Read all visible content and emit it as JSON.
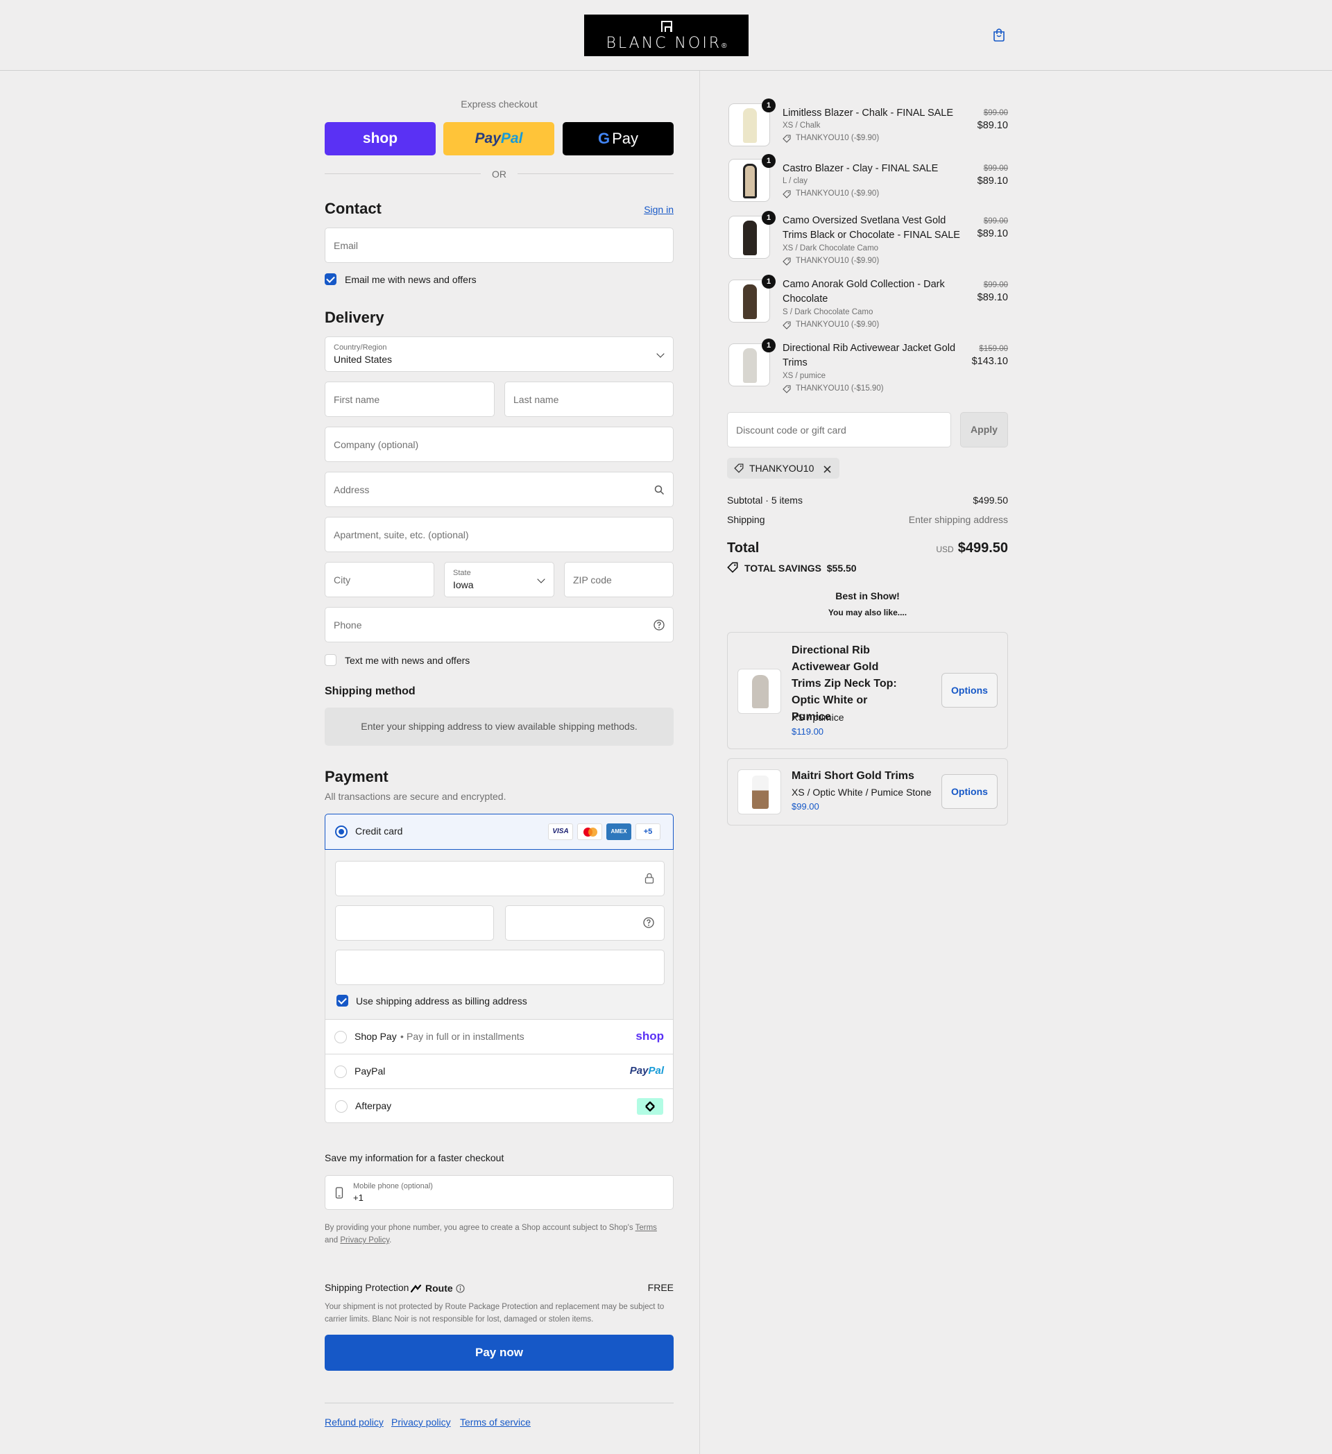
{
  "brand": {
    "name": "BLANC NOIR",
    "reg": "®"
  },
  "express": {
    "label": "Express checkout",
    "shop": "shop",
    "paypal_a": "Pay",
    "paypal_b": "Pal",
    "gpay_g": "G",
    "gpay": "Pay",
    "or": "OR"
  },
  "contact": {
    "title": "Contact",
    "sign_in": "Sign in",
    "email_placeholder": "Email",
    "email_opt_in": "Email me with news and offers"
  },
  "delivery": {
    "title": "Delivery",
    "country_label": "Country/Region",
    "country_value": "United States",
    "first_name": "First name",
    "last_name": "Last name",
    "company": "Company (optional)",
    "address": "Address",
    "apartment": "Apartment, suite, etc. (optional)",
    "city": "City",
    "state_label": "State",
    "state_value": "Iowa",
    "zip": "ZIP code",
    "phone": "Phone",
    "text_opt_in": "Text me with news and offers"
  },
  "shipping_method": {
    "title": "Shipping method",
    "notice": "Enter your shipping address to view available shipping methods."
  },
  "payment": {
    "title": "Payment",
    "subtitle": "All transactions are secure and encrypted.",
    "credit_card": "Credit card",
    "card_brands": [
      "VISA",
      "",
      "AMEX",
      "+5"
    ],
    "billing_same": "Use shipping address as billing address",
    "shop_pay": "Shop Pay",
    "shop_pay_desc": "Pay in full or in installments",
    "shop_logo": "shop",
    "paypal": "PayPal",
    "paypal_logo_a": "Pay",
    "paypal_logo_b": "Pal",
    "afterpay": "Afterpay"
  },
  "save_info": {
    "title": "Save my information for a faster checkout",
    "mobile_label": "Mobile phone (optional)",
    "mobile_value": "+1",
    "legal_a": "By providing your phone number, you agree to create a Shop account subject to Shop's ",
    "terms": "Terms",
    "legal_b": "and ",
    "privacy": "Privacy Policy",
    "legal_c": "."
  },
  "protection": {
    "label": "Shipping Protection",
    "route": "Route",
    "price": "FREE",
    "desc": "Your shipment is not protected by Route Package Protection and replacement may be subject to carrier limits. Blanc Noir is not responsible for lost, damaged or stolen items."
  },
  "pay_now": "Pay now",
  "footer": {
    "refund": "Refund policy",
    "privacy": "Privacy policy",
    "terms": "Terms of service"
  },
  "order": {
    "items": [
      {
        "name": "Limitless Blazer - Chalk - FINAL SALE",
        "variant": "XS / Chalk",
        "discount": "THANKYOU10 (-$9.90)",
        "old": "$99.00",
        "price": "$89.10",
        "qty": "1"
      },
      {
        "name": "Castro Blazer - Clay - FINAL SALE",
        "variant": "L / clay",
        "discount": "THANKYOU10 (-$9.90)",
        "old": "$99.00",
        "price": "$89.10",
        "qty": "1"
      },
      {
        "name": "Camo Oversized Svetlana Vest Gold Trims Black or Chocolate - FINAL SALE",
        "variant": "XS / Dark Chocolate Camo",
        "discount": "THANKYOU10 (-$9.90)",
        "old": "$99.00",
        "price": "$89.10",
        "qty": "1"
      },
      {
        "name": "Camo Anorak Gold Collection - Dark Chocolate",
        "variant": "S / Dark Chocolate Camo",
        "discount": "THANKYOU10 (-$9.90)",
        "old": "$99.00",
        "price": "$89.10",
        "qty": "1"
      },
      {
        "name": "Directional Rib Activewear Jacket Gold Trims",
        "variant": "XS / pumice",
        "discount": "THANKYOU10 (-$15.90)",
        "old": "$159.00",
        "price": "$143.10",
        "qty": "1"
      }
    ],
    "discount_placeholder": "Discount code or gift card",
    "apply": "Apply",
    "applied_code": "THANKYOU10",
    "subtotal_label": "Subtotal · 5 items",
    "subtotal": "$499.50",
    "shipping_label": "Shipping",
    "shipping_value": "Enter shipping address",
    "total_label": "Total",
    "currency": "USD",
    "total": "$499.50",
    "savings_label": "TOTAL SAVINGS",
    "savings": "$55.50"
  },
  "upsell": {
    "title": "Best in Show!",
    "subtitle": "You may also like....",
    "products": [
      {
        "name": "Directional Rib Activewear Gold Trims Zip Neck Top: Optic White or Pumice",
        "variant": "XS / pumice",
        "price": "$119.00",
        "button": "Options"
      },
      {
        "name": "Maitri Short Gold Trims",
        "variant": "XS / Optic White / Pumice Stone",
        "price": "$99.00",
        "button": "Options"
      }
    ]
  },
  "colors": {
    "accent": "#1658c7",
    "shop_purple": "#5a31f4",
    "paypal_yellow": "#ffc439",
    "afterpay_mint": "#b2fce4"
  }
}
